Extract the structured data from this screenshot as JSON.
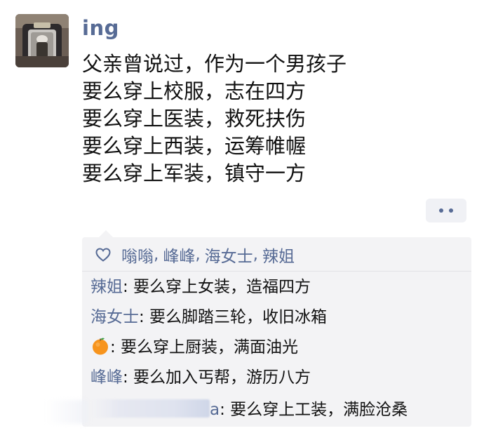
{
  "post": {
    "username": "ing",
    "avatar_icon": "avatar-photo-icon",
    "lines": [
      "父亲曾说过，作为一个男孩子",
      "要么穿上校服，志在四方",
      "要么穿上医装，救死扶伤",
      "要么穿上西装，运筹帷幄",
      "要么穿上军装，镇守一方"
    ]
  },
  "likes": {
    "icon": "heart-icon",
    "names": [
      "嗡嗡",
      "峰峰",
      "海女士",
      "辣姐"
    ],
    "separator": ","
  },
  "comments": [
    {
      "author": "辣姐",
      "text": ": 要么穿上女装，造福四方"
    },
    {
      "author": "海女士",
      "text": ": 要么脚踏三轮，收旧冰箱"
    },
    {
      "author_icon": "orange-icon",
      "text": ": 要么穿上厨装，满面油光"
    },
    {
      "author": "峰峰",
      "text": ": 要么加入丐帮，游历八方"
    },
    {
      "author": "a",
      "author_redacted": true,
      "text": ": 要么穿上工装，满脸沧桑"
    }
  ],
  "colors": {
    "name_blue": "#576b95",
    "text": "#111111",
    "comment_bg": "#f3f3f5"
  }
}
